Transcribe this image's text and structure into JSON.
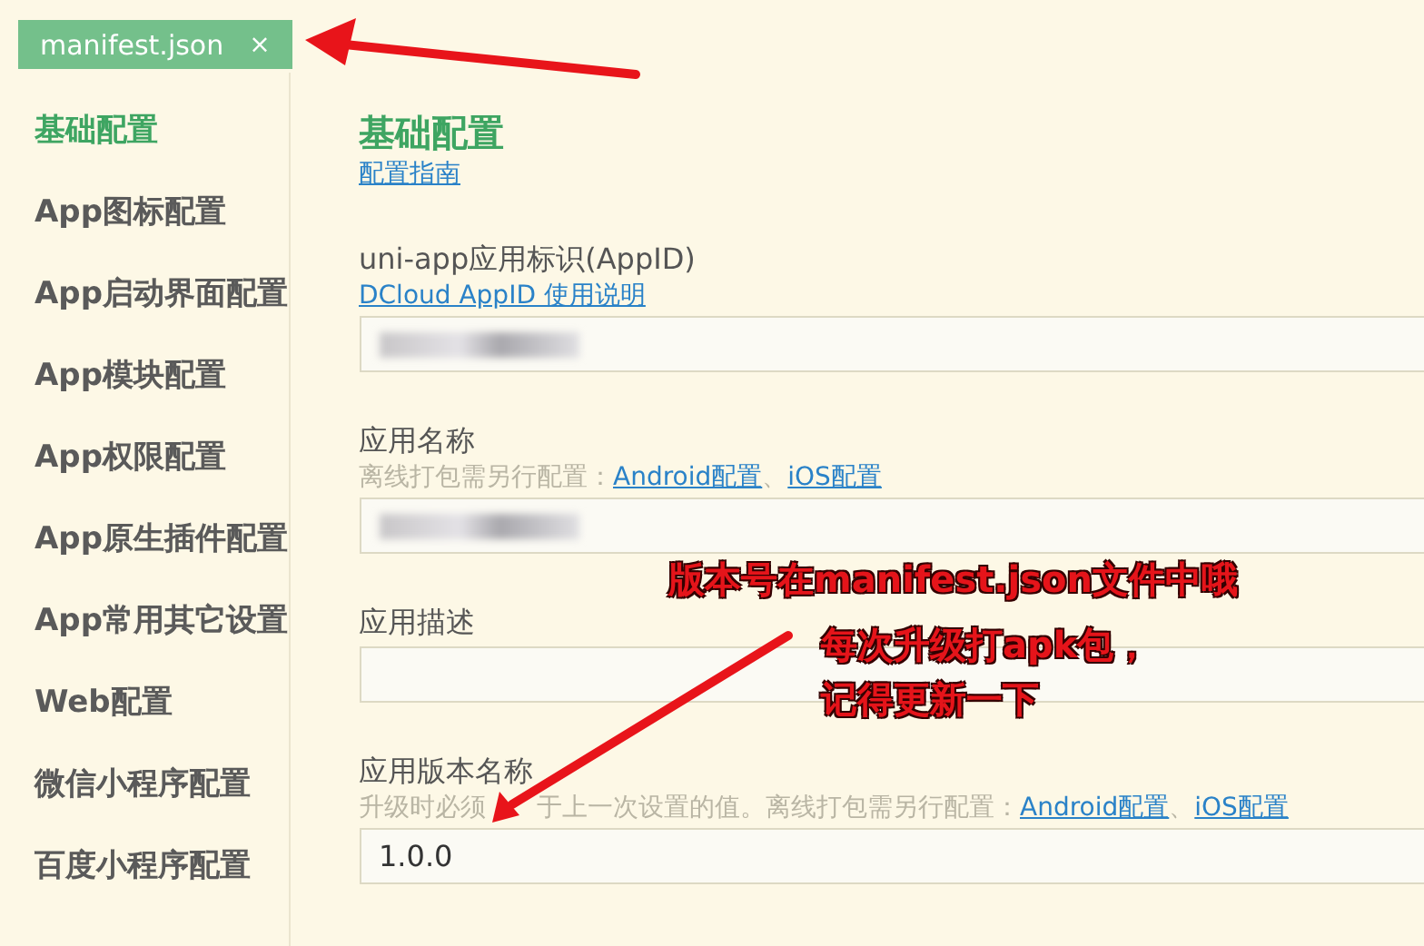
{
  "tabs": [
    {
      "label": "manifest.json",
      "close": "×",
      "selected": true
    }
  ],
  "sidebar": {
    "items": [
      {
        "label": "基础配置",
        "selected": true
      },
      {
        "label": "App图标配置",
        "selected": false
      },
      {
        "label": "App启动界面配置",
        "selected": false
      },
      {
        "label": "App模块配置",
        "selected": false
      },
      {
        "label": "App权限配置",
        "selected": false
      },
      {
        "label": "App原生插件配置",
        "selected": false
      },
      {
        "label": "App常用其它设置",
        "selected": false
      },
      {
        "label": "Web配置",
        "selected": false
      },
      {
        "label": "微信小程序配置",
        "selected": false
      },
      {
        "label": "百度小程序配置",
        "selected": false
      }
    ]
  },
  "content": {
    "title": "基础配置",
    "guide_link": "配置指南",
    "sections": [
      {
        "label": "uni-app应用标识(AppID)",
        "hint": [
          {
            "kind": "link",
            "text": "DCloud AppID 使用说明"
          }
        ],
        "field": {
          "kind": "blurred"
        }
      },
      {
        "label": "应用名称",
        "hint": [
          {
            "kind": "text",
            "text": "离线打包需另行配置："
          },
          {
            "kind": "link",
            "text": "Android配置"
          },
          {
            "kind": "text",
            "text": "、"
          },
          {
            "kind": "link",
            "text": "iOS配置"
          }
        ],
        "field": {
          "kind": "blurred"
        }
      },
      {
        "label": "应用描述",
        "field": {
          "kind": "empty"
        }
      },
      {
        "label": "应用版本名称",
        "hint": [
          {
            "kind": "text",
            "text": "升级时必须"
          },
          {
            "kind": "text",
            "text": "于上一次设置的值。离线打包需另行配置："
          },
          {
            "kind": "link",
            "text": "Android配置"
          },
          {
            "kind": "text",
            "text": "、"
          },
          {
            "kind": "link",
            "text": "iOS配置"
          }
        ],
        "field": {
          "kind": "text",
          "value": "1.0.0"
        }
      }
    ]
  },
  "annotations": [
    "版本号在manifest.json文件中哦",
    "每次升级打apk包，",
    "记得更新一下"
  ]
}
